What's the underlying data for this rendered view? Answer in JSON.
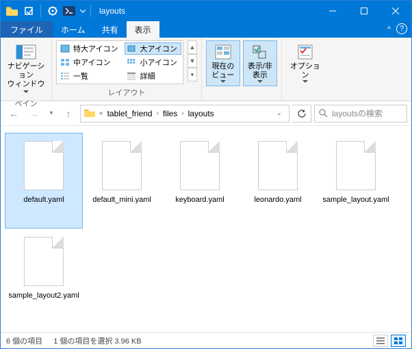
{
  "window": {
    "title": "layouts"
  },
  "tabs": {
    "file": "ファイル",
    "home": "ホーム",
    "share": "共有",
    "view": "表示"
  },
  "ribbon": {
    "pane": {
      "nav": "ナビゲーション\nウィンドウ",
      "label": "ペイン"
    },
    "layout": {
      "xl": "特大アイコン",
      "l": "大アイコン",
      "m": "中アイコン",
      "s": "小アイコン",
      "list": "一覧",
      "details": "詳細",
      "label": "レイアウト"
    },
    "curviews": {
      "current": "現在の\nビュー",
      "showhide": "表示/非\n表示",
      "label": ""
    },
    "options": {
      "options": "オプション"
    }
  },
  "breadcrumb": {
    "a": "tablet_friend",
    "b": "files",
    "c": "layouts"
  },
  "search": {
    "placeholder": "layoutsの検索"
  },
  "files": [
    {
      "name": "default.yaml"
    },
    {
      "name": "default_mini.yaml"
    },
    {
      "name": "keyboard.yaml"
    },
    {
      "name": "leonardo.yaml"
    },
    {
      "name": "sample_layout.yaml"
    },
    {
      "name": "sample_layout2.yaml"
    }
  ],
  "status": {
    "count": "6 個の項目",
    "selection": "1 個の項目を選択 3.96 KB"
  }
}
